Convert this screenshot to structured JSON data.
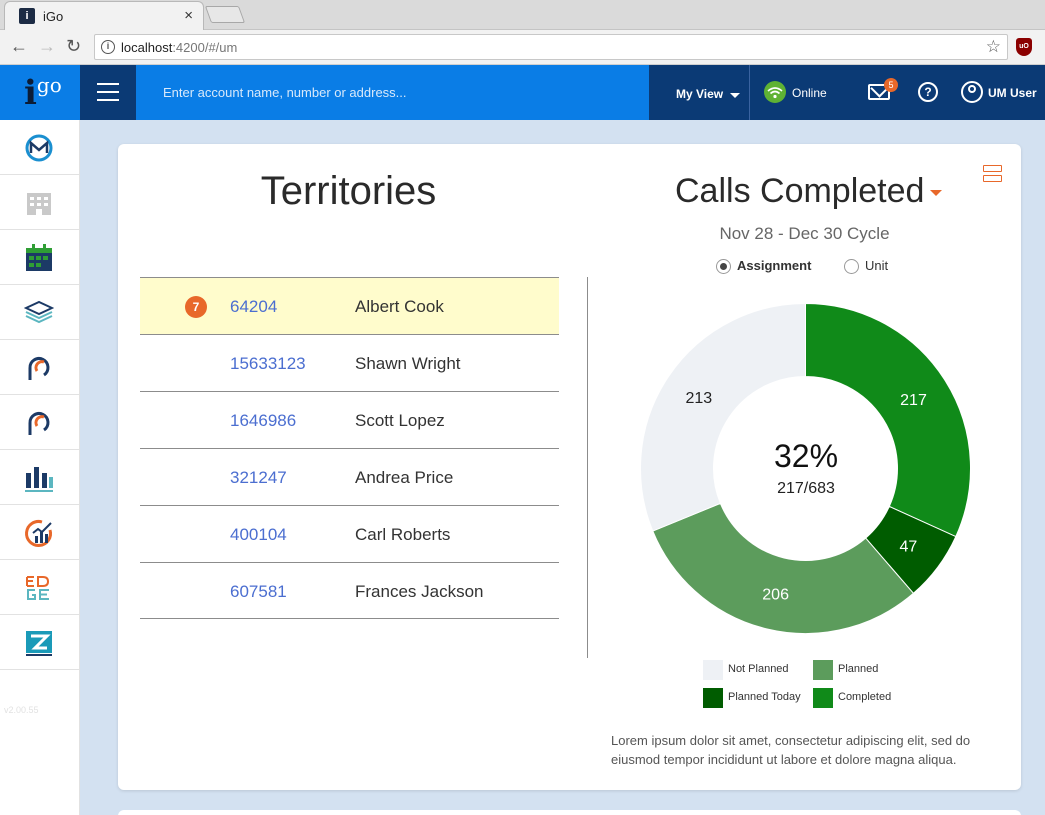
{
  "browser": {
    "tab_title": "iGo",
    "tab_favicon_letter": "i",
    "tab_close": "×",
    "url_host": "localhost",
    "url_path": ":4200/#/um",
    "ext_label": "uO"
  },
  "header": {
    "logo_i": "i",
    "logo_go": "go",
    "search_placeholder": "Enter account name, number or address...",
    "my_view_label": "My View",
    "status_label": "Online",
    "mail_count": "5",
    "help_glyph": "?",
    "user_label": "UM User",
    "colors": {
      "blue": "#0a7de6",
      "navy": "#0b3a75",
      "accent": "#e8682a",
      "online": "#5fb234"
    }
  },
  "sidebar": {
    "items": [
      {
        "name": "m-logo-icon"
      },
      {
        "name": "building-icon"
      },
      {
        "name": "calendar-icon"
      },
      {
        "name": "stack-icon"
      },
      {
        "name": "c-logo-icon"
      },
      {
        "name": "c-logo-alt-icon"
      },
      {
        "name": "bar-graph-icon"
      },
      {
        "name": "chart-check-icon"
      },
      {
        "name": "edge-logo-icon"
      },
      {
        "name": "arrow-box-icon"
      }
    ],
    "version": "v2.00.55"
  },
  "territories": {
    "title": "Territories",
    "rows": [
      {
        "badge": "7",
        "number": "64204",
        "name": "Albert Cook",
        "highlight": true
      },
      {
        "badge": "",
        "number": "15633123",
        "name": "Shawn Wright",
        "highlight": false
      },
      {
        "badge": "",
        "number": "1646986",
        "name": "Scott Lopez",
        "highlight": false
      },
      {
        "badge": "",
        "number": "321247",
        "name": "Andrea Price",
        "highlight": false
      },
      {
        "badge": "",
        "number": "400104",
        "name": "Carl Roberts",
        "highlight": false
      },
      {
        "badge": "",
        "number": "607581",
        "name": "Frances Jackson",
        "highlight": false
      }
    ]
  },
  "calls": {
    "title": "Calls Completed",
    "cycle": "Nov 28 - Dec 30 Cycle",
    "radio_assignment": "Assignment",
    "radio_unit": "Unit",
    "center_percent": "32%",
    "center_fraction": "217/683",
    "description": "Lorem ipsum dolor sit amet, consectetur adipiscing elit, sed do eiusmod tempor incididunt ut labore et dolore magna aliqua."
  },
  "chart_data": {
    "type": "pie",
    "categories": [
      "Completed",
      "Planned Today",
      "Planned",
      "Not Planned"
    ],
    "values": [
      217,
      47,
      206,
      213
    ],
    "colors": [
      "#108a19",
      "#005c00",
      "#5c9c5c",
      "#eef1f5"
    ],
    "label_colors": [
      "#ffffff",
      "#ffffff",
      "#ffffff",
      "#222222"
    ],
    "legend": [
      {
        "label": "Not Planned",
        "color": "#eef1f5"
      },
      {
        "label": "Planned",
        "color": "#5c9c5c"
      },
      {
        "label": "Planned Today",
        "color": "#005c00"
      },
      {
        "label": "Completed",
        "color": "#108a19"
      }
    ],
    "legend_placement": "bottom"
  }
}
